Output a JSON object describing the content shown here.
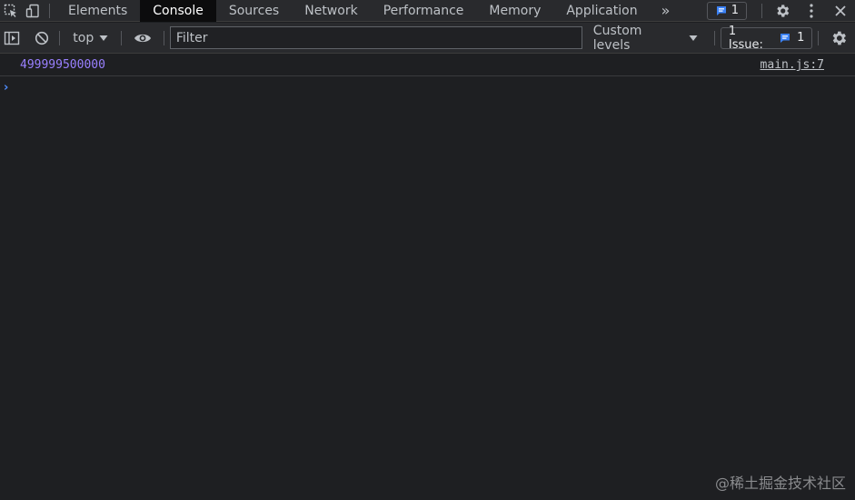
{
  "tabs": [
    {
      "label": "Elements"
    },
    {
      "label": "Console"
    },
    {
      "label": "Sources"
    },
    {
      "label": "Network"
    },
    {
      "label": "Performance"
    },
    {
      "label": "Memory"
    },
    {
      "label": "Application"
    }
  ],
  "active_tab": "Console",
  "more_tabs_icon": "chevron-double-right-icon",
  "messages_badge": {
    "count": "1",
    "icon": "message-icon"
  },
  "toolbar": {
    "context": "top",
    "filter_placeholder": "Filter",
    "filter_value": "",
    "levels_label": "Custom levels",
    "issues_label": "1 Issue:",
    "issues_count": "1"
  },
  "console": {
    "messages": [
      {
        "value": "499999500000",
        "source": "main.js:7"
      }
    ],
    "prompt_symbol": "›"
  },
  "watermark": "@稀土掘金技术社区",
  "colors": {
    "background": "#1e1f22",
    "toolbar": "#292a2d",
    "active_tab": "#0c0c0d",
    "number": "#9980ff",
    "prompt": "#4e8cff",
    "badge_blue": "#3b82f6"
  }
}
